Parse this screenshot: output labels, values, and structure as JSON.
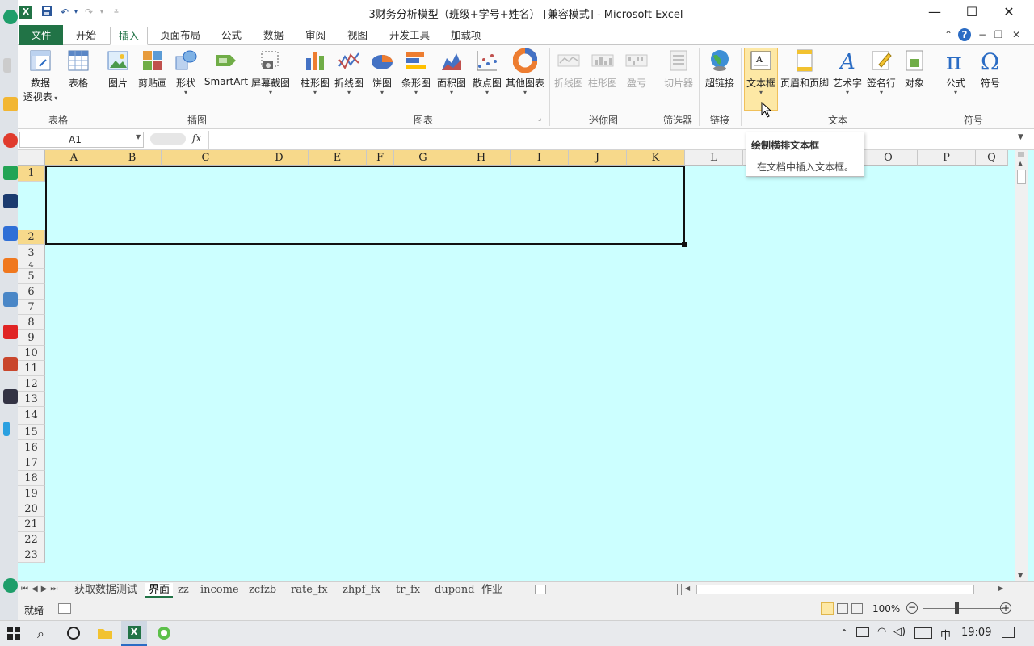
{
  "window": {
    "title": "3财务分析模型（班级+学号+姓名） [兼容模式] - Microsoft Excel",
    "minimize": "—",
    "maximize": "☐",
    "close": "✕"
  },
  "tabs": [
    "文件",
    "开始",
    "插入",
    "页面布局",
    "公式",
    "数据",
    "审阅",
    "视图",
    "开发工具",
    "加载项"
  ],
  "active_tab": "插入",
  "ribbon": {
    "groups": {
      "tables": "表格",
      "illustrations": "插图",
      "charts": "图表",
      "sparklines": "迷你图",
      "filter": "筛选器",
      "links": "链接",
      "text": "文本",
      "symbols": "符号"
    },
    "buttons": {
      "pivot1": "数据",
      "pivot2": "透视表",
      "table": "表格",
      "picture": "图片",
      "clipart": "剪贴画",
      "shapes": "形状",
      "smartart": "SmartArt",
      "screenshot": "屏幕截图",
      "column_chart": "柱形图",
      "line_chart": "折线图",
      "pie_chart": "饼图",
      "bar_chart": "条形图",
      "area_chart": "面积图",
      "scatter_chart": "散点图",
      "other_charts": "其他图表",
      "spark_line": "折线图",
      "spark_column": "柱形图",
      "spark_winloss": "盈亏",
      "slicer": "切片器",
      "hyperlink": "超链接",
      "textbox": "文本框",
      "header_footer": "页眉和页脚",
      "wordart": "艺术字",
      "signature": "签名行",
      "object": "对象",
      "equation": "公式",
      "symbol": "符号"
    }
  },
  "formula_bar": {
    "name_box": "A1",
    "fx": "fx",
    "value": ""
  },
  "tooltip": {
    "title": "绘制横排文本框",
    "body": "在文档中插入文本框。"
  },
  "columns": [
    "A",
    "B",
    "C",
    "D",
    "E",
    "F",
    "G",
    "H",
    "I",
    "J",
    "K",
    "L",
    "M",
    "N",
    "O",
    "P",
    "Q"
  ],
  "rows": [
    "1",
    "2",
    "3",
    "4",
    "5",
    "6",
    "7",
    "8",
    "9",
    "10",
    "11",
    "12",
    "13",
    "14",
    "15",
    "16",
    "17",
    "18",
    "19",
    "20",
    "21",
    "22",
    "23"
  ],
  "sheets": [
    "获取数据测试",
    "界面",
    "zz",
    "income",
    "zcfzb",
    "rate_fx",
    "zhpf_fx",
    "tr_fx",
    "dupond",
    "作业"
  ],
  "active_sheet": "界面",
  "status": {
    "ready": "就绪",
    "zoom": "100%"
  },
  "taskbar": {
    "time": "19:09",
    "ime": "中"
  },
  "colors": {
    "excel_green": "#217346",
    "cell_fill": "#ccffff",
    "selected_header": "#f7d98b"
  }
}
